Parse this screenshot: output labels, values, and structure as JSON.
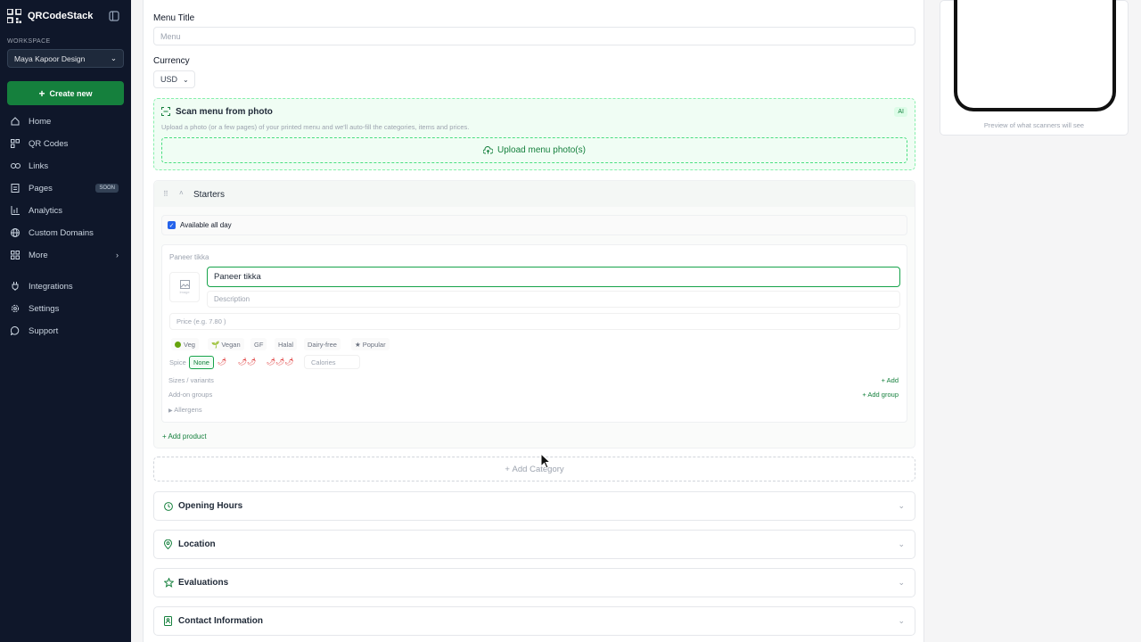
{
  "app": {
    "name": "QRCodeStack"
  },
  "workspace": {
    "label": "WORKSPACE",
    "current": "Maya Kapoor Design"
  },
  "create_label": "Create new",
  "nav": {
    "home": "Home",
    "qr": "QR Codes",
    "links": "Links",
    "pages": "Pages",
    "pages_badge": "SOON",
    "analytics": "Analytics",
    "domains": "Custom Domains",
    "more": "More",
    "integrations": "Integrations",
    "settings": "Settings",
    "support": "Support"
  },
  "form": {
    "menu_title_label": "Menu Title",
    "menu_title_placeholder": "Menu",
    "currency_label": "Currency",
    "currency_value": "USD"
  },
  "scan": {
    "title": "Scan menu from photo",
    "badge": "AI",
    "desc": "Upload a photo (or a few pages) of your printed menu and we'll auto-fill the categories, items and prices.",
    "upload": "Upload menu photo(s)"
  },
  "category": {
    "name": "Starters",
    "available": "Available all day"
  },
  "product": {
    "heading": "Paneer tikka",
    "name_value": "Paneer tikka",
    "desc_placeholder": "Description",
    "price_placeholder": "Price (e.g. 7.80 )",
    "image_caption": "Image",
    "tags": [
      "Veg",
      "Vegan",
      "GF",
      "Halal",
      "Dairy-free",
      "Popular"
    ],
    "spice_label": "Spice",
    "spice_none": "None",
    "spice_1": "🌶",
    "spice_2": "🌶🌶",
    "spice_3": "🌶🌶🌶",
    "calories_placeholder": "Calories",
    "sizes_label": "Sizes / variants",
    "sizes_add": "Add",
    "addons_label": "Add-on groups",
    "addons_add": "Add group",
    "allergens": "Allergens"
  },
  "add_product": "Add product",
  "add_category": "Add Category",
  "sections": [
    "Opening Hours",
    "Location",
    "Evaluations",
    "Contact Information"
  ],
  "preview_caption": "Preview of what scanners will see",
  "colors": {
    "sidebar": "#0f172a",
    "accent": "#15803d"
  }
}
